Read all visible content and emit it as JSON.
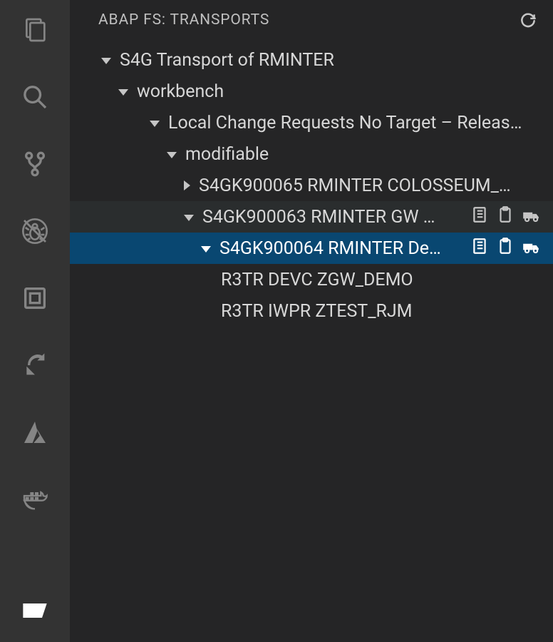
{
  "panel": {
    "title": "ABAP FS: TRANSPORTS"
  },
  "activityBar": {
    "items": [
      {
        "name": "explorer-icon"
      },
      {
        "name": "search-icon"
      },
      {
        "name": "source-control-icon"
      },
      {
        "name": "debug-icon"
      },
      {
        "name": "abap-transport-icon"
      },
      {
        "name": "live-share-icon"
      },
      {
        "name": "azure-icon"
      },
      {
        "name": "docker-icon"
      }
    ],
    "bottomItem": {
      "name": "active-tool-icon"
    }
  },
  "tree": {
    "root": {
      "label": "S4G Transport of RMINTER",
      "expanded": true
    },
    "workbench": {
      "label": "workbench",
      "expanded": true
    },
    "localChangeReq": {
      "label": "Local Change Requests No Target – Releas…",
      "expanded": true
    },
    "modifiable": {
      "label": "modifiable",
      "expanded": true
    },
    "tr065": {
      "label": "S4GK900065 RMINTER COLOSSEUM_…",
      "expanded": false
    },
    "tr063": {
      "label": "S4GK900063 RMINTER GW …",
      "expanded": true
    },
    "tr064": {
      "label": "S4GK900064 RMINTER De…",
      "expanded": true
    },
    "leaf1": {
      "label": "R3TR DEVC ZGW_DEMO"
    },
    "leaf2": {
      "label": "R3TR IWPR ZTEST_RJM"
    },
    "actionNames": {
      "openRef": "open-reference-icon",
      "clipboard": "clipboard-icon",
      "release": "release-transport-icon"
    }
  }
}
